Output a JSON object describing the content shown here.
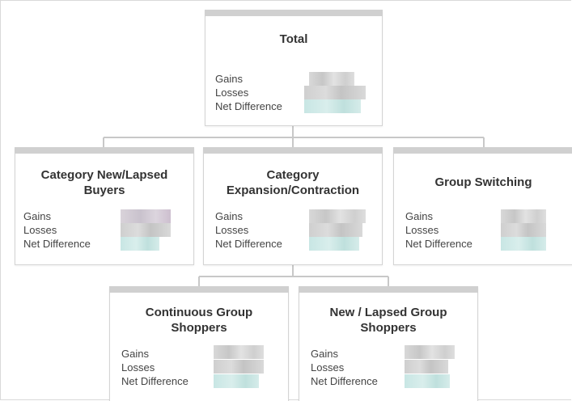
{
  "labels": {
    "gains": "Gains",
    "losses": "Losses",
    "net": "Net Difference"
  },
  "nodes": {
    "total": {
      "title": "Total"
    },
    "new_lapsed_buyers": {
      "title_line1": "Category New/Lapsed",
      "title_line2": "Buyers"
    },
    "expansion": {
      "title_line1": "Category",
      "title_line2": "Expansion/Contraction"
    },
    "switching": {
      "title": "Group Switching"
    },
    "continuous": {
      "title_line1": "Continuous Group",
      "title_line2": "Shoppers"
    },
    "new_lapsed_group": {
      "title_line1": "New / Lapsed Group",
      "title_line2": "Shoppers"
    }
  },
  "colors": {
    "connector": "#c8c8c8",
    "node_border": "#d4d4d4",
    "header_bar": "#d0d0d0",
    "net_blur": "#c8e6e4"
  }
}
